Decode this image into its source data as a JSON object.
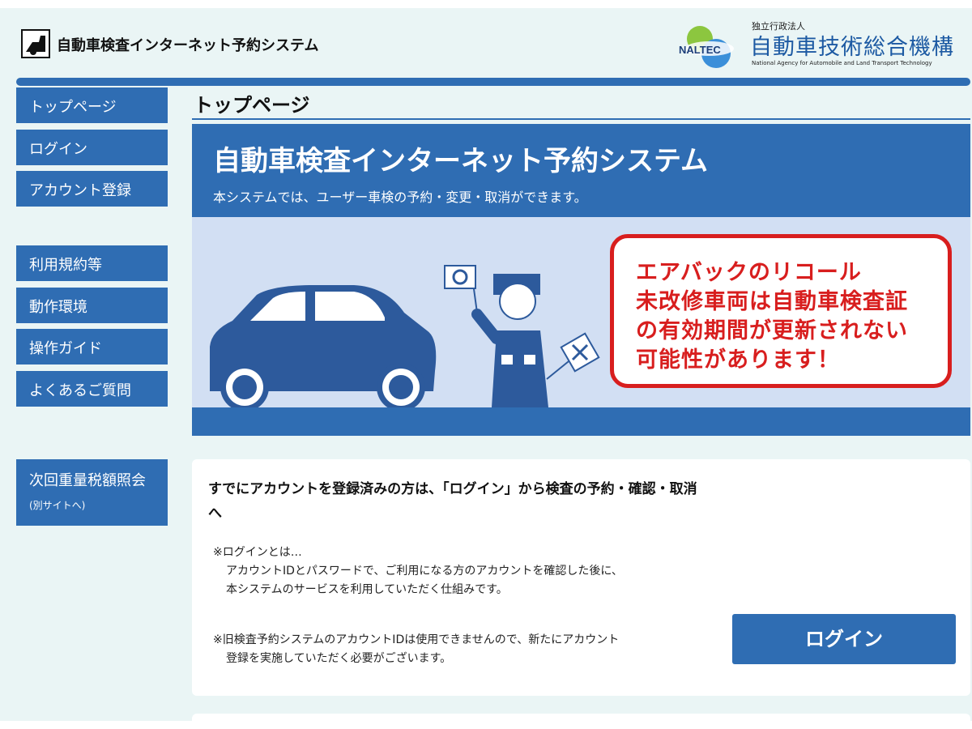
{
  "header": {
    "system_title": "自動車検査インターネット予約システム",
    "org_logo_text": "NALTEC",
    "org_small": "独立行政法人",
    "org_name": "自動車技術総合機構",
    "org_english": "National Agency for Automobile and Land Transport Technology"
  },
  "sidebar": {
    "items": [
      {
        "label": "トップページ"
      },
      {
        "label": "ログイン"
      },
      {
        "label": "アカウント登録"
      },
      {
        "label": "利用規約等"
      },
      {
        "label": "動作環境"
      },
      {
        "label": "操作ガイド"
      },
      {
        "label": "よくあるご質問"
      },
      {
        "label": "次回重量税額照会",
        "sub": "(別サイトへ)"
      }
    ]
  },
  "main": {
    "page_title": "トップページ",
    "banner": {
      "title": "自動車検査インターネット予約システム",
      "subtitle": "本システムでは、ユーザー車検の予約・変更・取消ができます。",
      "recall_lines": [
        "エアバックのリコール",
        "未改修車両は自動車検査証",
        "の有効期間が更新されない",
        "可能性があります！"
      ]
    },
    "card": {
      "heading": "すでにアカウントを登録済みの方は、「ログイン」から検査の予約・確認・取消へ",
      "note1_title": "※ログインとは…",
      "note1_line1": "アカウントIDとパスワードで、ご利用になる方のアカウントを確認した後に、",
      "note1_line2": "本システムのサービスを利用していただく仕組みです。",
      "note2_line1": "※旧検査予約システムのアカウントIDは使用できませんので、新たにアカウント",
      "note2_line2": "登録を実施していただく必要がございます。",
      "login_label": "ログイン"
    }
  },
  "colors": {
    "primary": "#2f6db3",
    "recall_red": "#d81e1e",
    "page_bg": "#eaf5f5",
    "banner_light": "#d2dff3"
  }
}
